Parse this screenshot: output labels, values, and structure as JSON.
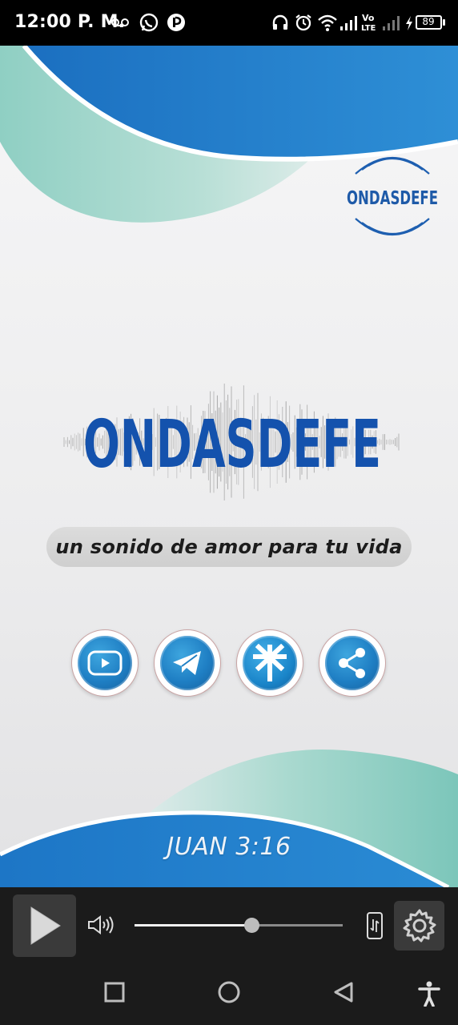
{
  "status_bar": {
    "time": "12:00 P. M.",
    "battery_level": "89",
    "icons": [
      "voicemail-icon",
      "whatsapp-icon",
      "app-notification-icon",
      "headphones-icon",
      "alarm-icon",
      "wifi-icon",
      "signal-icon",
      "volte-icon",
      "signal-icon",
      "charging-icon",
      "battery-icon"
    ]
  },
  "banner": {
    "corner_logo_text": "ONDASDEFE",
    "main_logo_text": "ONDASDEFE",
    "tagline": "un sonido de amor para tu vida",
    "verse": "JUAN 3:16",
    "colors": {
      "brand_blue": "#1565c0",
      "wave_blue": "#2a86cf",
      "wave_teal": "#7fc8bd"
    }
  },
  "social": [
    {
      "id": "youtube",
      "icon": "youtube-icon"
    },
    {
      "id": "telegram",
      "icon": "telegram-icon"
    },
    {
      "id": "linktree",
      "icon": "linktree-icon"
    },
    {
      "id": "share",
      "icon": "share-icon"
    }
  ],
  "player": {
    "play_icon": "play-icon",
    "volume_icon": "volume-icon",
    "volume_level": 0.56,
    "cast_icon": "phone-transfer-icon",
    "settings_icon": "gear-icon"
  },
  "nav": [
    "recents-icon",
    "home-icon",
    "back-icon",
    "accessibility-icon"
  ]
}
